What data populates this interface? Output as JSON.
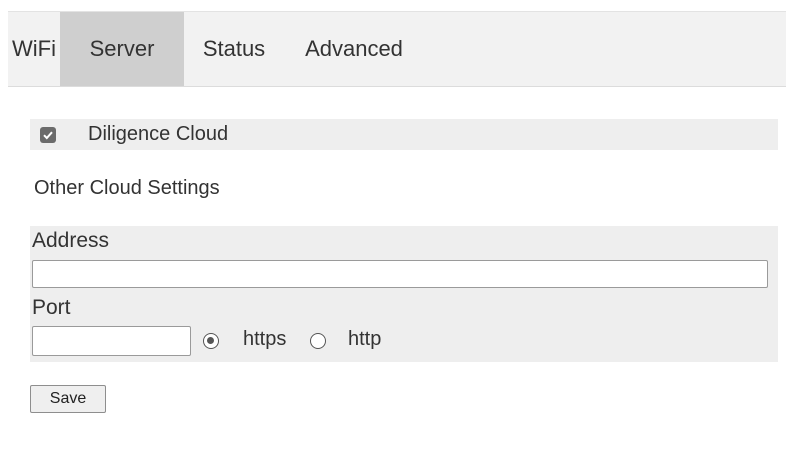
{
  "tabs": [
    {
      "label": "WiFi",
      "active": false
    },
    {
      "label": "Server",
      "active": true
    },
    {
      "label": "Status",
      "active": false
    },
    {
      "label": "Advanced",
      "active": false
    }
  ],
  "cloud": {
    "label": "Diligence Cloud",
    "checked": true
  },
  "other_cloud": {
    "title": "Other Cloud Settings",
    "address_label": "Address",
    "address_value": "",
    "port_label": "Port",
    "port_value": "",
    "protocols": [
      {
        "label": "https",
        "selected": true
      },
      {
        "label": "http",
        "selected": false
      }
    ]
  },
  "save_label": "Save",
  "colors": {
    "active_tab": "#cfcfcf",
    "tab_bar": "#f2f2f2",
    "panel": "#eeeeee"
  }
}
